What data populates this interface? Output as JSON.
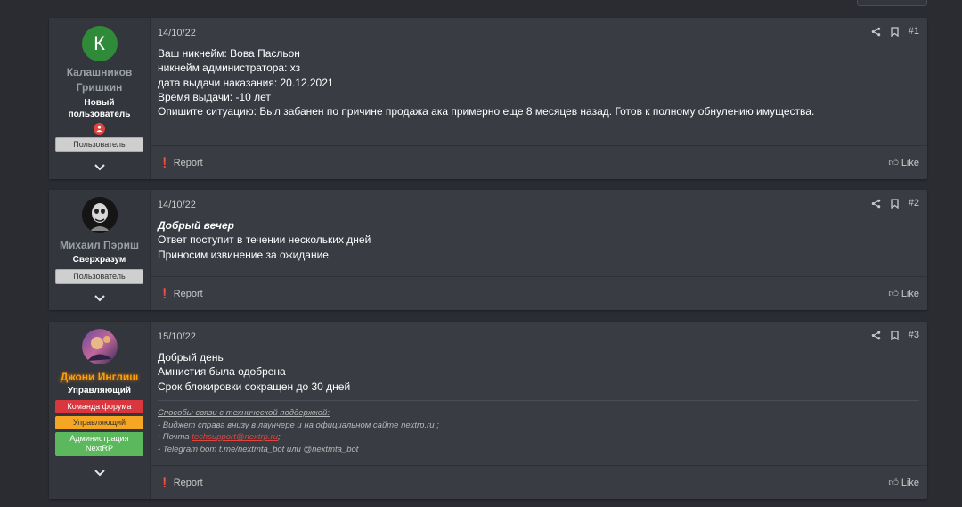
{
  "posts": [
    {
      "date": "14/10/22",
      "number": "#1",
      "author": {
        "name_line1": "Калашников",
        "name_line2": "Гришкин",
        "title_line1": "Новый",
        "title_line2": "пользователь",
        "avatar_letter": "К",
        "banners": [
          "Пользователь"
        ]
      },
      "lines": [
        "Ваш никнейм: Вова Пасльон",
        "никнейм администратора: хз",
        "дата выдачи наказания: 20.12.2021",
        "Время выдачи: -10 лет",
        "Опишите ситуацию: Был забанен по причине продажа ака примерно еще 8 месяцев назад. Готов к полному обнулению имущества."
      ]
    },
    {
      "date": "14/10/22",
      "number": "#2",
      "author": {
        "name": "Михаил Пэриш",
        "title": "Сверхразум",
        "banners": [
          "Пользователь"
        ]
      },
      "greeting": "Добрый вечер",
      "lines": [
        "Ответ поступит в течении нескольких дней",
        "Приносим извинение за ожидание"
      ]
    },
    {
      "date": "15/10/22",
      "number": "#3",
      "author": {
        "name": "Джони Инглиш",
        "title": "Управляющий",
        "banners": [
          "Команда форума",
          "Управляющий",
          "Администрация",
          "NextRP"
        ]
      },
      "lines": [
        "Добрый день",
        "Амнистия была одобрена",
        "Срок блокировки сокращен до 30 дней"
      ],
      "signature": {
        "heading": "Способы связи с технической поддержкой:",
        "line1": "- Виджет справа внизу в лаунчере и на официальном сайте nextrp.ru ;",
        "line2_prefix": "- Почта ",
        "email": "techsupport@nextrp.ru",
        "line2_suffix": ";",
        "line3": "- Telegram бот t.me/nextmta_bot или @nextmta_bot"
      }
    }
  ],
  "actions": {
    "report": "Report",
    "like": "Like"
  },
  "colors": {
    "background": "#2a2c31",
    "post_bg": "#393c43",
    "user_col_bg": "#33363c",
    "staff_name": "#ffa000",
    "email": "#e0443e"
  }
}
